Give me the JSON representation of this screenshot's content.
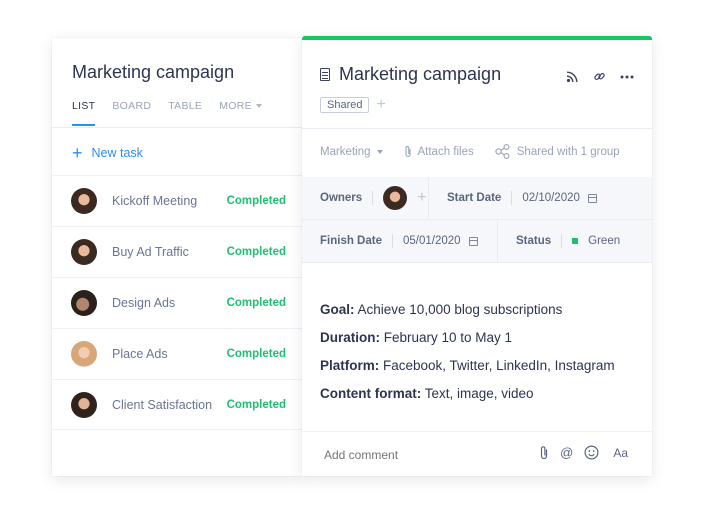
{
  "left": {
    "title": "Marketing campaign",
    "tabs": [
      {
        "label": "LIST",
        "active": true
      },
      {
        "label": "BOARD",
        "active": false
      },
      {
        "label": "TABLE",
        "active": false
      },
      {
        "label": "MORE",
        "active": false
      }
    ],
    "new_task_label": "New task",
    "tasks": [
      {
        "name": "Kickoff Meeting",
        "status": "Completed",
        "avatar": "woman-dark-hair"
      },
      {
        "name": "Buy Ad Traffic",
        "status": "Completed",
        "avatar": "woman-dark-hair"
      },
      {
        "name": "Design Ads",
        "status": "Completed",
        "avatar": "man-dark"
      },
      {
        "name": "Place Ads",
        "status": "Completed",
        "avatar": "woman-blonde"
      },
      {
        "name": "Client Satisfaction",
        "status": "Completed",
        "avatar": "woman-dark-hair"
      }
    ]
  },
  "right": {
    "title": "Marketing campaign",
    "header_icons": [
      "rss-icon",
      "link-icon",
      "more-icon"
    ],
    "shared_chip": "Shared",
    "meta": {
      "folder": "Marketing",
      "attach": "Attach files",
      "shared_with": "Shared with 1 group"
    },
    "fields": {
      "owners_label": "Owners",
      "start_label": "Start Date",
      "start_value": "02/10/2020",
      "finish_label": "Finish Date",
      "finish_value": "05/01/2020",
      "status_label": "Status",
      "status_value": "Green"
    },
    "description": [
      {
        "label": "Goal:",
        "text": " Achieve 10,000 blog subscriptions"
      },
      {
        "label": "Duration:",
        "text": " February 10 to May 1"
      },
      {
        "label": "Platform:",
        "text": " Facebook, Twitter, LinkedIn, Instagram"
      },
      {
        "label": "Content format:",
        "text": " Text, image, video"
      }
    ],
    "comment_placeholder": "Add comment",
    "comment_tools": {
      "format": "Aa"
    }
  },
  "colors": {
    "accent_blue": "#2a8ff0",
    "success_green": "#1fbf72",
    "top_bar_green": "#12c95f"
  }
}
